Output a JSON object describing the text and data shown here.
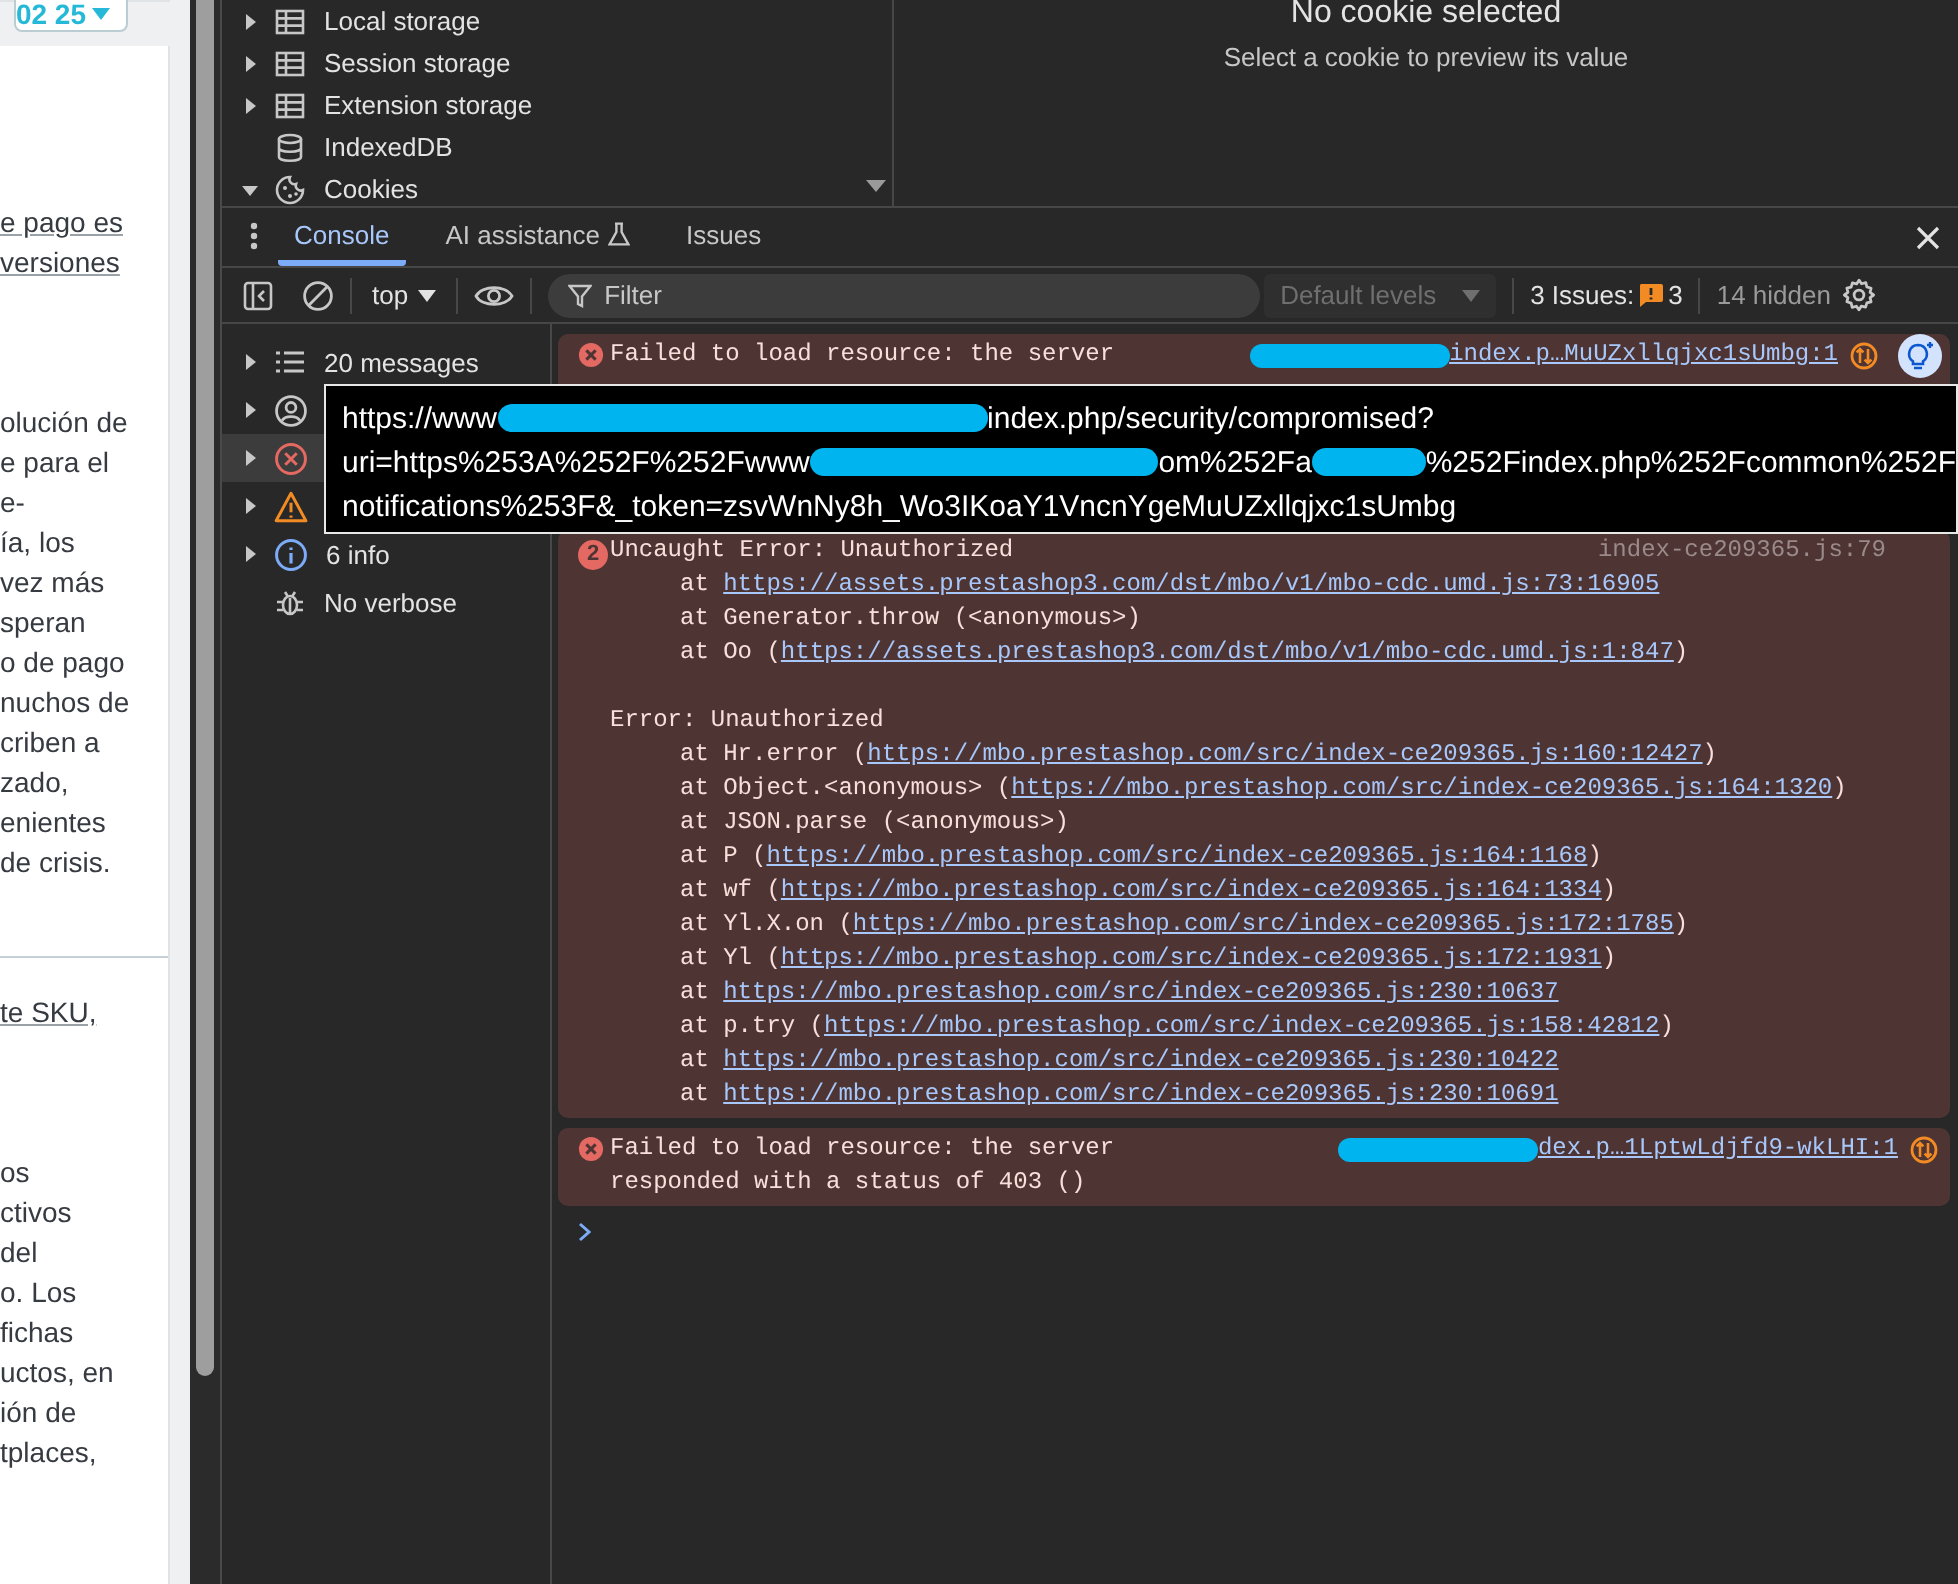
{
  "page": {
    "date_button": "02 25",
    "blocks": [
      {
        "kind": "link",
        "rule_above": false,
        "lines": [
          "e pago es",
          "versiones"
        ]
      },
      {
        "kind": "paragraph",
        "rule_above": false,
        "lines": [
          "olución de",
          "e para el",
          "e-",
          "ía, los",
          "vez más",
          "speran",
          "o de pago",
          "nuchos de",
          "criben a",
          "zado,",
          "enientes",
          "de crisis."
        ]
      },
      {
        "kind": "link",
        "rule_above": true,
        "lines": [
          "te SKU,"
        ]
      },
      {
        "kind": "paragraph",
        "rule_above": false,
        "lines": [
          "os",
          "ctivos",
          "del",
          "o. Los",
          "fichas",
          "uctos, en",
          "ión de",
          "tplaces,"
        ]
      }
    ]
  },
  "storage_tree": [
    {
      "kind": "table",
      "label": "Local storage",
      "expanded": false
    },
    {
      "kind": "table",
      "label": "Session storage",
      "expanded": false
    },
    {
      "kind": "table",
      "label": "Extension storage",
      "expanded": false
    },
    {
      "kind": "database",
      "label": "IndexedDB"
    },
    {
      "kind": "cookie",
      "label": "Cookies",
      "expanded": true
    }
  ],
  "cookie_preview": {
    "title": "No cookie selected",
    "hint": "Select a cookie to preview its value"
  },
  "drawer_tabs": [
    {
      "label": "Console",
      "selected": true,
      "experimental": false
    },
    {
      "label": "AI assistance",
      "selected": false,
      "experimental": true
    },
    {
      "label": "Issues",
      "selected": false,
      "experimental": false
    }
  ],
  "toolbar": {
    "context": "top",
    "filter_placeholder": "Filter",
    "levels": "Default levels",
    "levels_disabled": true,
    "issues_label": "3 Issues:",
    "issues_count": "3",
    "hidden": "14 hidden"
  },
  "sidebar": [
    {
      "kind": "messages",
      "label": "20 messages",
      "selected": false
    },
    {
      "kind": "user",
      "selected": false
    },
    {
      "kind": "error",
      "selected": true
    },
    {
      "kind": "warning",
      "selected": false
    },
    {
      "kind": "info",
      "label": "6 info",
      "selected": false
    },
    {
      "kind": "verbose",
      "label": "No verbose",
      "selected": false
    }
  ],
  "messages": [
    {
      "kind": "error",
      "lines": [
        {
          "text": "Failed to load resource: the server"
        }
      ],
      "covered": true,
      "source": "index.p…MuUZxllqjxc1sUmbg:1",
      "source_redacted": true,
      "network": true,
      "ai_button": true
    },
    {
      "kind": "error",
      "count": "2",
      "lines": [
        {
          "kind": "title",
          "text": "Uncaught Error: Unauthorized"
        },
        {
          "kind": "frame",
          "before": "at ",
          "link": "https://assets.prestashop3.com/dst/mbo/v1/mbo-cdc.umd.js:73:16905"
        },
        {
          "kind": "frame",
          "before": "at Generator.throw (<anonymous>)"
        },
        {
          "kind": "frame",
          "before": "at Oo (",
          "link": "https://assets.prestashop3.com/dst/mbo/v1/mbo-cdc.umd.js:1:847",
          "after": ")"
        },
        {
          "kind": "blank"
        },
        {
          "kind": "heading",
          "text": "Error: Unauthorized"
        },
        {
          "kind": "frame",
          "before": "at Hr.error (",
          "link": "https://mbo.prestashop.com/src/index-ce209365.js:160:12427",
          "after": ")"
        },
        {
          "kind": "frame",
          "before": "at Object.<anonymous> (",
          "link": "https://mbo.prestashop.com/src/index-ce209365.js:164:1320",
          "after": ")"
        },
        {
          "kind": "frame",
          "before": "at JSON.parse (<anonymous>)"
        },
        {
          "kind": "frame",
          "before": "at P (",
          "link": "https://mbo.prestashop.com/src/index-ce209365.js:164:1168",
          "after": ")"
        },
        {
          "kind": "frame",
          "before": "at wf (",
          "link": "https://mbo.prestashop.com/src/index-ce209365.js:164:1334",
          "after": ")"
        },
        {
          "kind": "frame",
          "before": "at Yl.X.on (",
          "link": "https://mbo.prestashop.com/src/index-ce209365.js:172:1785",
          "after": ")"
        },
        {
          "kind": "frame",
          "before": "at Yl (",
          "link": "https://mbo.prestashop.com/src/index-ce209365.js:172:1931",
          "after": ")"
        },
        {
          "kind": "frame",
          "before": "at ",
          "link": "https://mbo.prestashop.com/src/index-ce209365.js:230:10637"
        },
        {
          "kind": "frame",
          "before": "at p.try (",
          "link": "https://mbo.prestashop.com/src/index-ce209365.js:158:42812",
          "after": ")"
        },
        {
          "kind": "frame",
          "before": "at ",
          "link": "https://mbo.prestashop.com/src/index-ce209365.js:230:10422"
        },
        {
          "kind": "frame",
          "before": "at ",
          "link": "https://mbo.prestashop.com/src/index-ce209365.js:230:10691"
        }
      ],
      "covered": false,
      "source": "index-ce209365.js:79",
      "source_redacted": false,
      "network": false,
      "ai_button": false
    },
    {
      "kind": "error",
      "lines": [
        {
          "text": "Failed to load resource: the server"
        },
        {
          "text": "responded with a status of 403 ()"
        }
      ],
      "covered": false,
      "source": "dex.p…1LptwLdjfd9-wkLHI:1",
      "source_redacted": true,
      "network": true,
      "ai_button": false
    }
  ],
  "tooltip": {
    "lines": [
      [
        {
          "text": "https://www"
        },
        {
          "kind": "redacted"
        },
        {
          "text": "index.php/security/compromised?"
        }
      ],
      [
        {
          "text": "uri=https%253A%252F%252Fwww"
        },
        {
          "kind": "redacted"
        },
        {
          "text": "om%252Fa"
        },
        {
          "kind": "redacted"
        },
        {
          "text": "%252Findex.php%252Fcommon%252F"
        }
      ],
      [
        {
          "text": "notifications%253F&_token=zsvWnNy8h_Wo3IKoaY1VncnYgeMuUZxllqjxc1sUmbg"
        }
      ]
    ]
  }
}
